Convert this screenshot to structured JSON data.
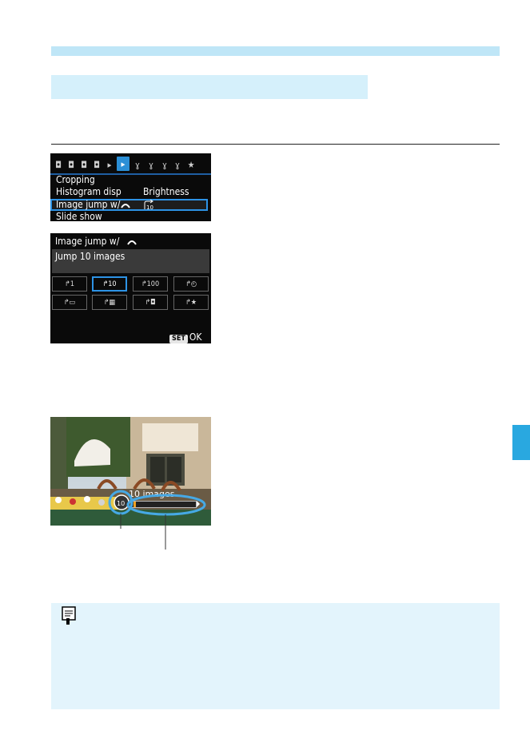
{
  "menu": {
    "tabs": [
      "camera-1-icon",
      "camera-2-icon",
      "camera-3-icon",
      "camera-4-icon",
      "playback-1-icon",
      "playback-2-icon",
      "setup-1-icon",
      "setup-2-icon",
      "setup-3-icon",
      "setup-4-icon",
      "mymenu-icon"
    ],
    "items": [
      {
        "label": "Cropping",
        "value": ""
      },
      {
        "label": "Histogram disp",
        "value": "Brightness"
      },
      {
        "label": "Image jump w/",
        "value": ""
      },
      {
        "label": "Slide show",
        "value": ""
      }
    ]
  },
  "dialog": {
    "title": "Image jump w/",
    "selected_description": "Jump 10 images",
    "options": [
      "1-image-jump-icon",
      "10-image-jump-icon",
      "100-image-jump-icon",
      "date-jump-icon",
      "folder-jump-icon",
      "movie-jump-icon",
      "stills-jump-icon",
      "rating-jump-icon"
    ],
    "ok_badge": "SET",
    "ok_label": "OK"
  },
  "photo": {
    "jump_label": "10 images"
  },
  "colors": {
    "accent_blue": "#2d93e5",
    "light_band": "#bfe6f7",
    "tab_blue": "#29a8e0",
    "note_bg": "#e3f4fc"
  }
}
